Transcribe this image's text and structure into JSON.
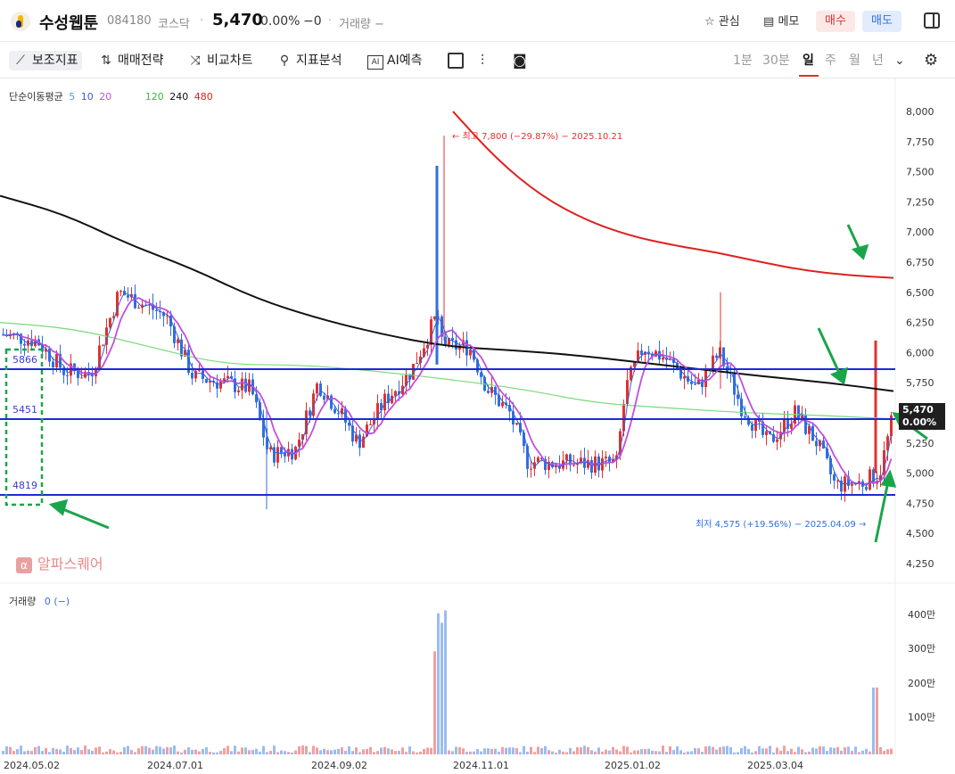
{
  "header": {
    "name": "수성웹툰",
    "code": "084180",
    "market": "코스닥",
    "price": "5,470",
    "change_pct": "0.00%",
    "change_abs": "−0",
    "volume_label": "거래량 −",
    "watch_label": "관심",
    "memo_label": "메모",
    "buy_label": "매수",
    "sell_label": "매도",
    "colors": {
      "buy": "#e03131",
      "sell": "#2f6fe0"
    }
  },
  "toolbar": {
    "indicators": "보조지표",
    "strategy": "매매전략",
    "compare": "비교차트",
    "analysis": "지표분석",
    "ai": "AI예측",
    "periods": [
      "1분",
      "30분",
      "일",
      "주",
      "월",
      "년"
    ],
    "active_period": "일"
  },
  "legend": {
    "title": "단순이동평균",
    "ma": [
      {
        "label": "5",
        "color": "#5b9bd5"
      },
      {
        "label": "10",
        "color": "#3b5fd5"
      },
      {
        "label": "20",
        "color": "#c04fe0"
      },
      {
        "label": "120",
        "color": "#5ad45a"
      },
      {
        "label": "240",
        "color": "#111111"
      },
      {
        "label": "480",
        "color": "#e02020"
      }
    ]
  },
  "annotations": {
    "high": "← 최고 7,800 (−29.87%) − 2025.10.21",
    "low": "최저 4,575 (+19.56%) − 2025.04.09 →",
    "levels": [
      "5866",
      "5451",
      "4819"
    ]
  },
  "current": {
    "price": "5,470",
    "pct": "0.00%"
  },
  "watermark": "알파스퀘어",
  "volume": {
    "label": "거래량",
    "value": "0 (−)"
  },
  "chart_data": {
    "type": "line",
    "ylim": [
      4250,
      8100
    ],
    "y_ticks": [
      "8,000",
      "7,750",
      "7,500",
      "7,250",
      "7,000",
      "6,750",
      "6,500",
      "6,250",
      "6,000",
      "5,750",
      "5,500",
      "5,250",
      "5,000",
      "4,750",
      "4,500",
      "4,250"
    ],
    "x_ticks": [
      "2024.05.02",
      "2024.07.01",
      "2024.09.02",
      "2024.11.01",
      "2025.01.02",
      "2025.03.04"
    ],
    "volume_ticks": [
      "400만",
      "300만",
      "200만",
      "100만"
    ],
    "horizontal_levels": [
      5866,
      5451,
      4819
    ],
    "high": {
      "price": 7800,
      "date": "2025.10.21"
    },
    "low": {
      "price": 4575,
      "date": "2025.04.09"
    },
    "last": 5470,
    "series": [
      {
        "name": "240",
        "values": [
          7300,
          7150,
          6900,
          6700,
          6450,
          6280,
          6150,
          6050,
          6020,
          5980,
          5920,
          5860,
          5800,
          5750,
          5680
        ]
      },
      {
        "name": "480",
        "values": [
          8000,
          7600,
          7300,
          7100,
          6970,
          6890,
          6830,
          6750,
          6680,
          6640,
          6620
        ]
      },
      {
        "name": "120",
        "values": [
          6250,
          6200,
          6050,
          5900,
          5900,
          5850,
          5780,
          5700,
          5580,
          5540,
          5500,
          5480,
          5450
        ]
      }
    ]
  }
}
